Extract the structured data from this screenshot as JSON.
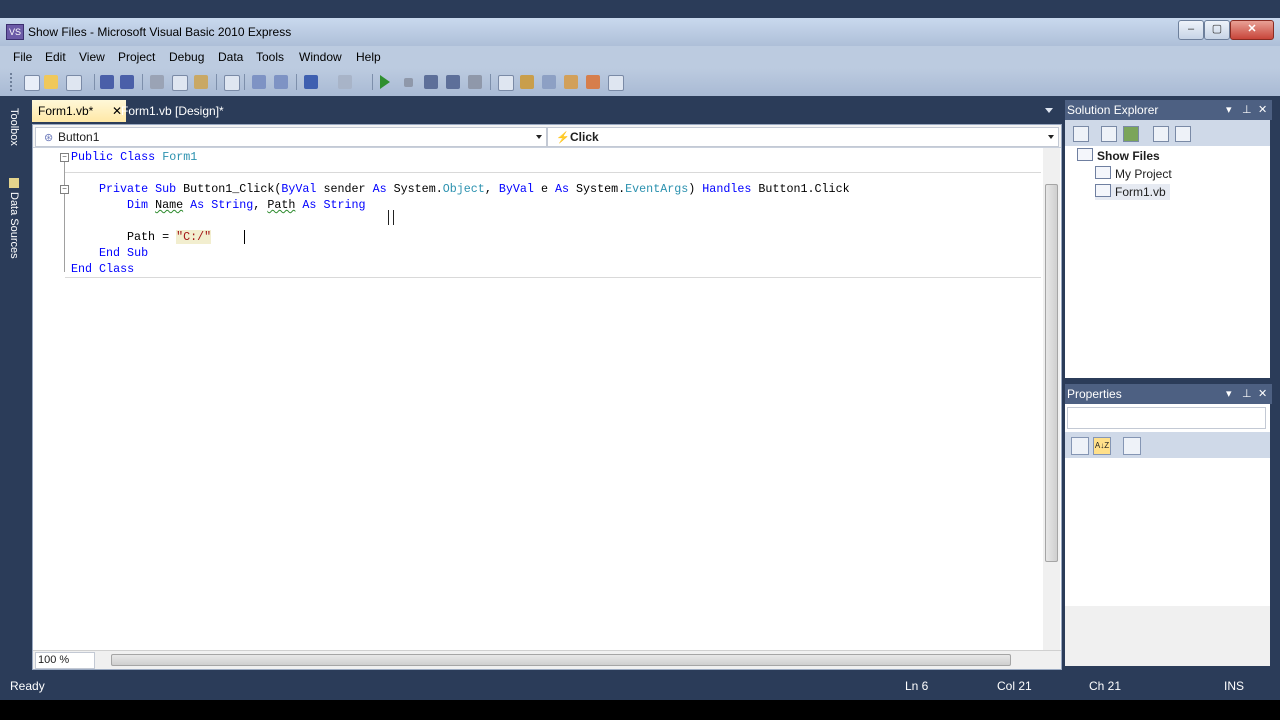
{
  "window": {
    "title": "Show Files - Microsoft Visual Basic 2010 Express",
    "app_icon": "VS",
    "minimize": "–",
    "maximize": "▢",
    "close": "✕"
  },
  "menu": [
    "File",
    "Edit",
    "View",
    "Project",
    "Debug",
    "Data",
    "Tools",
    "Window",
    "Help"
  ],
  "left_tabs": {
    "toolbox": "Toolbox",
    "data_sources": "Data Sources"
  },
  "doc_tabs": [
    {
      "label": "Form1.vb*",
      "active": true,
      "close": "✕"
    },
    {
      "label": "Form1.vb [Design]*",
      "active": false
    }
  ],
  "nav": {
    "object_combo": "Button1",
    "event_combo": "Click",
    "object_icon": "⊛",
    "event_icon": "⚡"
  },
  "code": {
    "l1_kw": "Public Class",
    "l1_id": "Form1",
    "l3_kw1": "Private Sub",
    "l3_name": "Button1_Click(",
    "l3_kw2": "ByVal",
    "l3_p1": "sender",
    "l3_kw3": "As",
    "l3_t1a": "System.",
    "l3_t1b": "Object",
    "l3_comma": ",",
    "l3_kw4": "ByVal",
    "l3_p2": "e",
    "l3_kw5": "As",
    "l3_t2a": "System.",
    "l3_t2b": "EventArgs",
    "l3_close": ")",
    "l3_kw6": "Handles",
    "l3_handler": "Button1.Click",
    "l4_kw1": "Dim",
    "l4_v1": "Name",
    "l4_kw2": "As",
    "l4_t1": "String",
    "l4_comma": ",",
    "l4_v2": "Path",
    "l4_kw3": "As",
    "l4_t2": "String",
    "l6_v": "Path",
    "l6_eq": "=",
    "l6_str": "\"C:/\"",
    "l7_kw": "End Sub",
    "l8_kw": "End Class"
  },
  "zoom": "100 %",
  "solution_explorer": {
    "header": "Solution Explorer",
    "solution": "Show Files",
    "items": [
      "My Project",
      "Form1.vb"
    ]
  },
  "properties": {
    "header": "Properties",
    "sort_icon": "A↓Z"
  },
  "status": {
    "ready": "Ready",
    "ln": "Ln 6",
    "col": "Col 21",
    "ch": "Ch 21",
    "ins": "INS"
  },
  "panel_buttons": {
    "dropdown": "▾",
    "pin": "⊥",
    "close": "✕"
  }
}
